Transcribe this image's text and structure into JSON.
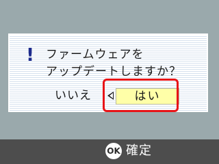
{
  "dialog": {
    "message_line1": "ファームウェアを",
    "message_line2": "アップデートしますか？",
    "icon": "exclamation-icon",
    "no_label": "いいえ",
    "yes_label": "はい"
  },
  "footer": {
    "ok_icon_text": "OK",
    "confirm_label": "確定"
  },
  "colors": {
    "screen_bg": "#9aa9ac",
    "selected_button": "#ffffa8",
    "highlight": "#e81418",
    "footer_bg": "#4d4d4d",
    "icon": "#1c2a8c"
  }
}
